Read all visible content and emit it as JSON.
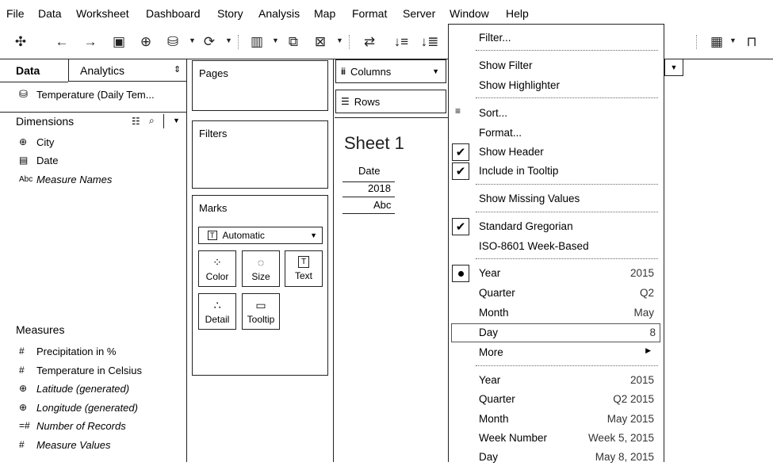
{
  "menubar": [
    "File",
    "Data",
    "Worksheet",
    "Dashboard",
    "Story",
    "Analysis",
    "Map",
    "Format",
    "Server",
    "Window",
    "Help"
  ],
  "data_pane": {
    "tab_data": "Data",
    "tab_analytics": "Analytics",
    "datasource": "Temperature (Daily Tem...",
    "dimensions_header": "Dimensions",
    "dimensions": [
      {
        "icon": "globe-icon",
        "glyph": "⊕",
        "label": "City",
        "italic": false
      },
      {
        "icon": "calendar-icon",
        "glyph": "▤",
        "label": "Date",
        "italic": false
      },
      {
        "icon": "abc-icon",
        "glyph": "Abc",
        "label": "Measure Names",
        "italic": true
      }
    ],
    "measures_header": "Measures",
    "measures": [
      {
        "icon": "number-icon",
        "glyph": "#",
        "label": "Precipitation in %",
        "italic": false
      },
      {
        "icon": "number-icon",
        "glyph": "#",
        "label": "Temperature in Celsius",
        "italic": false
      },
      {
        "icon": "globe-icon",
        "glyph": "⊕",
        "label": "Latitude (generated)",
        "italic": true
      },
      {
        "icon": "globe-icon",
        "glyph": "⊕",
        "label": "Longitude (generated)",
        "italic": true
      },
      {
        "icon": "number-equal-icon",
        "glyph": "=#",
        "label": "Number of Records",
        "italic": true
      },
      {
        "icon": "number-icon",
        "glyph": "#",
        "label": "Measure Values",
        "italic": true
      }
    ]
  },
  "cards": {
    "pages": "Pages",
    "filters": "Filters",
    "marks": "Marks",
    "mark_type": "Automatic",
    "mark_buttons": [
      {
        "label": "Color",
        "glyph": "⁘"
      },
      {
        "label": "Size",
        "glyph": "◌"
      },
      {
        "label": "Text",
        "glyph": "T"
      },
      {
        "label": "Detail",
        "glyph": "∴"
      },
      {
        "label": "Tooltip",
        "glyph": "▭"
      }
    ]
  },
  "shelves": {
    "columns": "Columns",
    "rows": "Rows"
  },
  "sheet": {
    "title": "Sheet 1",
    "header": "Date",
    "year": "2018",
    "cell": "Abc"
  },
  "context_menu": {
    "filter": "Filter...",
    "show_filter": "Show Filter",
    "show_highlighter": "Show Highlighter",
    "sort": "Sort...",
    "format": "Format...",
    "show_header": "Show Header",
    "include_tooltip": "Include in Tooltip",
    "show_missing": "Show Missing Values",
    "standard_gregorian": "Standard Gregorian",
    "iso_week": "ISO-8601 Week-Based",
    "discrete": [
      {
        "label": "Year",
        "value": "2015"
      },
      {
        "label": "Quarter",
        "value": "Q2"
      },
      {
        "label": "Month",
        "value": "May"
      },
      {
        "label": "Day",
        "value": "8"
      },
      {
        "label": "More",
        "value": ""
      }
    ],
    "continuous": [
      {
        "label": "Year",
        "value": "2015"
      },
      {
        "label": "Quarter",
        "value": "Q2 2015"
      },
      {
        "label": "Month",
        "value": "May 2015"
      },
      {
        "label": "Week Number",
        "value": "Week 5, 2015"
      },
      {
        "label": "Day",
        "value": "May 8, 2015"
      }
    ]
  }
}
